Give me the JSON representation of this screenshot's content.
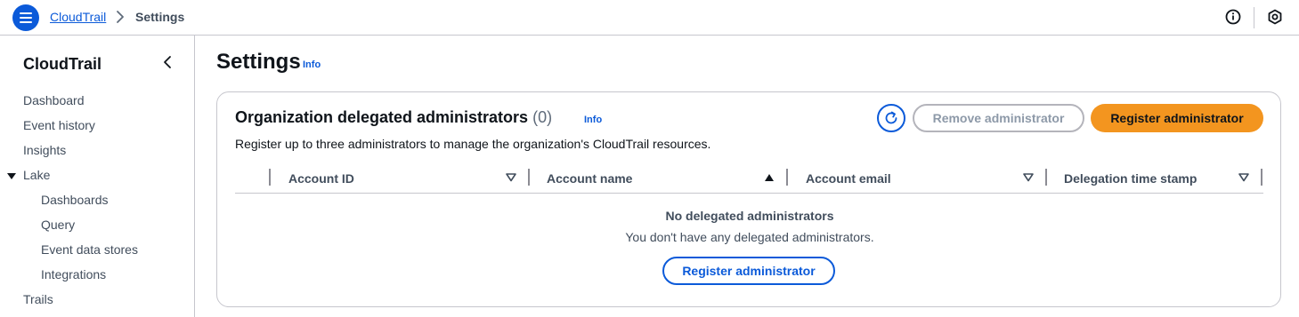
{
  "header": {
    "breadcrumb": [
      {
        "label": "CloudTrail"
      },
      {
        "label": "Settings"
      }
    ]
  },
  "sidebar": {
    "title": "CloudTrail",
    "items": [
      {
        "label": "Dashboard"
      },
      {
        "label": "Event history"
      },
      {
        "label": "Insights"
      },
      {
        "label": "Lake"
      },
      {
        "label": "Dashboards"
      },
      {
        "label": "Query"
      },
      {
        "label": "Event data stores"
      },
      {
        "label": "Integrations"
      },
      {
        "label": "Trails"
      }
    ]
  },
  "main": {
    "title": "Settings",
    "info_label": "Info",
    "card": {
      "title": "Organization delegated administrators",
      "count": "(0)",
      "info_label": "Info",
      "description": "Register up to three administrators to manage the organization's CloudTrail resources.",
      "remove_label": "Remove administrator",
      "register_label": "Register administrator",
      "columns": [
        {
          "label": "Account ID",
          "sort": "desc"
        },
        {
          "label": "Account name",
          "sort": "asc"
        },
        {
          "label": "Account email",
          "sort": "desc"
        },
        {
          "label": "Delegation time stamp",
          "sort": "desc"
        }
      ],
      "empty_title": "No delegated administrators",
      "empty_description": "You don't have any delegated administrators.",
      "empty_register_label": "Register administrator"
    }
  },
  "colors": {
    "accent": "#0b5ad9",
    "primary_button": "#f3951f",
    "border": "#c6c6cd"
  }
}
